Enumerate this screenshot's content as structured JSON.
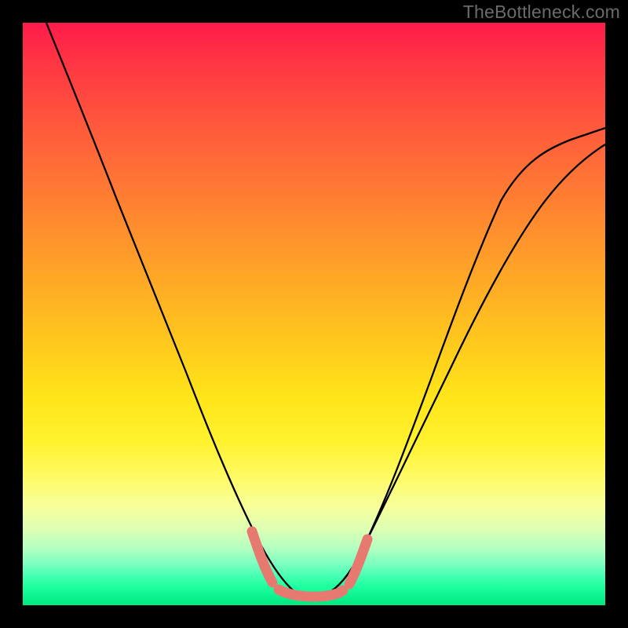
{
  "watermark": {
    "text": "TheBottleneck.com"
  },
  "colors": {
    "frame": "#000000",
    "curve": "#000000",
    "marker": "#e77a70",
    "gradient_top": "#ff1b4a",
    "gradient_bottom": "#00e77e"
  },
  "chart_data": {
    "type": "line",
    "title": "",
    "xlabel": "",
    "ylabel": "",
    "xlim": [
      0,
      100
    ],
    "ylim": [
      0,
      100
    ],
    "grid": false,
    "legend": false,
    "annotations": [
      "TheBottleneck.com"
    ],
    "series": [
      {
        "name": "bottleneck-curve",
        "x": [
          4,
          8,
          12,
          16,
          20,
          24,
          28,
          32,
          36,
          39,
          42,
          45,
          48,
          50,
          53,
          56,
          60,
          66,
          72,
          78,
          84,
          90,
          96,
          100
        ],
        "values": [
          100,
          90,
          80,
          70,
          60,
          50,
          40,
          30,
          20,
          12,
          7,
          3.5,
          1.5,
          1,
          1.5,
          3.5,
          8,
          18,
          29,
          40,
          51,
          62,
          72,
          79
        ]
      },
      {
        "name": "optimal-range",
        "x": [
          39,
          42,
          44,
          46,
          48,
          50,
          52,
          54,
          56
        ],
        "values": [
          12,
          7,
          4.5,
          2.8,
          1.8,
          1.3,
          1.8,
          2.8,
          4.5
        ]
      }
    ]
  }
}
